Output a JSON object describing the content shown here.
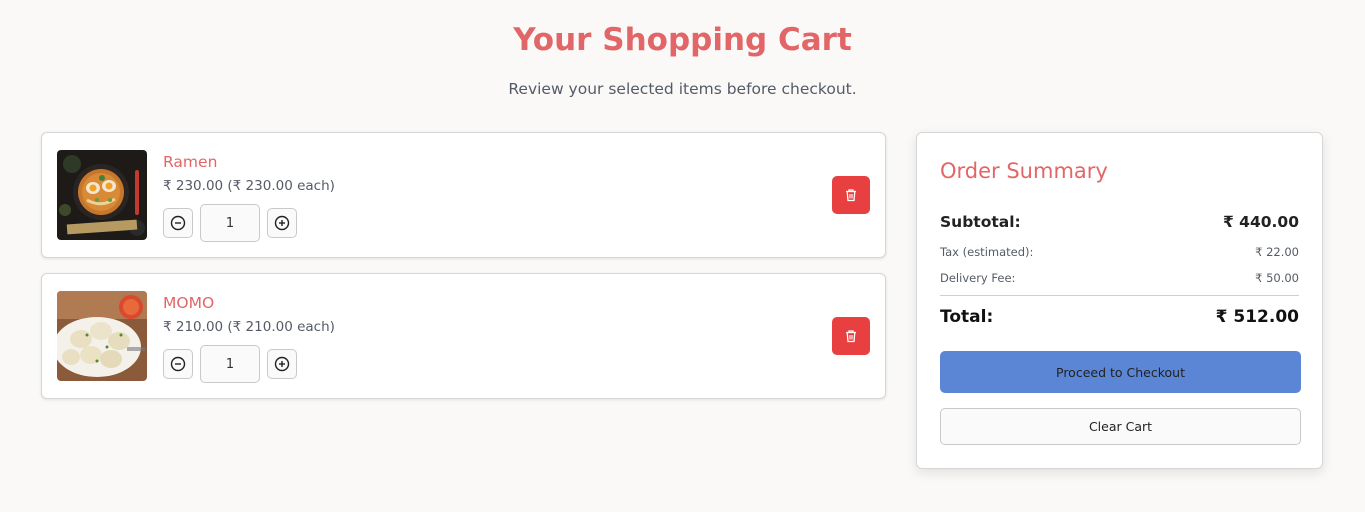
{
  "header": {
    "title": "Your Shopping Cart",
    "subtitle": "Review your selected items before checkout."
  },
  "cart": {
    "items": [
      {
        "name": "Ramen",
        "price_line": "₹ 230.00 (₹ 230.00 each)",
        "quantity": "1",
        "image": "ramen-bowl-photo"
      },
      {
        "name": "MOMO",
        "price_line": "₹ 210.00 (₹ 210.00 each)",
        "quantity": "1",
        "image": "momo-dumplings-photo"
      }
    ],
    "icons": {
      "decrease": "minus-circle-icon",
      "increase": "plus-circle-icon",
      "delete": "trash-icon"
    }
  },
  "summary": {
    "title": "Order Summary",
    "subtotal_label": "Subtotal:",
    "subtotal_value": "₹ 440.00",
    "tax_label": "Tax (estimated):",
    "tax_value": "₹ 22.00",
    "delivery_label": "Delivery Fee:",
    "delivery_value": "₹ 50.00",
    "total_label": "Total:",
    "total_value": "₹ 512.00",
    "checkout_label": "Proceed to Checkout",
    "clear_label": "Clear Cart"
  },
  "colors": {
    "accent": "#e26667",
    "delete": "#e84040",
    "checkout": "#5b86d6",
    "background": "#faf9f8"
  }
}
